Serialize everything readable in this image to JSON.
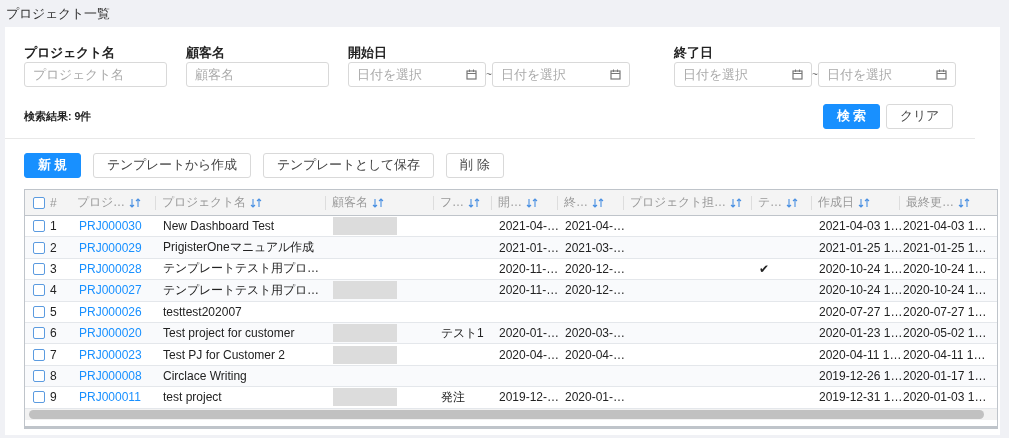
{
  "page_title": "プロジェクト一覧",
  "filters": [
    {
      "kind": "text",
      "label": "プロジェクト名",
      "placeholder": "プロジェクト名"
    },
    {
      "kind": "text",
      "label": "顧客名",
      "placeholder": "顧客名"
    },
    {
      "kind": "range",
      "label": "開始日",
      "placeholder_from": "日付を選択",
      "separator": "~",
      "placeholder_to": "日付を選択"
    },
    {
      "kind": "range",
      "label": "終了日",
      "placeholder_from": "日付を選択",
      "separator": "~",
      "placeholder_to": "日付を選択"
    }
  ],
  "result_count": "検索結果: 9件",
  "search_buttons": [
    {
      "label": "検 索",
      "primary": true
    },
    {
      "label": "クリア",
      "primary": false
    }
  ],
  "toolbar_buttons": [
    {
      "label": "新 規",
      "primary": true
    },
    {
      "label": "テンプレートから作成",
      "primary": false
    },
    {
      "label": "テンプレートとして保存",
      "primary": false
    },
    {
      "label": "削 除",
      "primary": false
    }
  ],
  "table": {
    "all_selected": false,
    "columns": [
      {
        "label": "#",
        "sortable": false
      },
      {
        "label": "プロジ…",
        "sortable": true
      },
      {
        "label": "プロジェクト名",
        "sortable": true
      },
      {
        "label": "顧客名",
        "sortable": true
      },
      {
        "label": "フ…",
        "sortable": true
      },
      {
        "label": "開…",
        "sortable": true
      },
      {
        "label": "終…",
        "sortable": true
      },
      {
        "label": "プロジェクト担…",
        "sortable": true
      },
      {
        "label": "テ…",
        "sortable": true
      },
      {
        "label": "作成日",
        "sortable": true
      },
      {
        "label": "最終更…",
        "sortable": true
      }
    ],
    "rows": [
      {
        "selected": false,
        "cells": [
          "1",
          "PRJ000030",
          "New Dashboard Test",
          "",
          "",
          "2021-04-…",
          "2021-04-…",
          "",
          "",
          "2021-04-03 1…",
          "2021-04-03 1…"
        ],
        "customer_redacted": true
      },
      {
        "selected": false,
        "cells": [
          "2",
          "PRJ000029",
          "PrigisterOneマニュアル作成",
          "",
          "",
          "2021-01-…",
          "2021-03-…",
          "",
          "",
          "2021-01-25 1…",
          "2021-01-25 1…"
        ],
        "customer_redacted": false
      },
      {
        "selected": false,
        "cells": [
          "3",
          "PRJ000028",
          "テンプレートテスト用プロ…",
          "",
          "",
          "2020-11-…",
          "2020-12-…",
          "",
          "✔",
          "2020-10-24 1…",
          "2020-10-24 1…"
        ],
        "customer_redacted": false
      },
      {
        "selected": false,
        "cells": [
          "4",
          "PRJ000027",
          "テンプレートテスト用プロ…",
          "",
          "",
          "2020-11-…",
          "2020-12-…",
          "",
          "",
          "2020-10-24 1…",
          "2020-10-24 1…"
        ],
        "customer_redacted": true
      },
      {
        "selected": false,
        "cells": [
          "5",
          "PRJ000026",
          "testtest202007",
          "",
          "",
          "",
          "",
          "",
          "",
          "2020-07-27 1…",
          "2020-07-27 1…"
        ],
        "customer_redacted": false
      },
      {
        "selected": false,
        "cells": [
          "6",
          "PRJ000020",
          "Test project for customer",
          "",
          "テスト1",
          "2020-01-…",
          "2020-03-…",
          "",
          "",
          "2020-01-23 1…",
          "2020-05-02 1…"
        ],
        "customer_redacted": true
      },
      {
        "selected": false,
        "cells": [
          "7",
          "PRJ000023",
          "Test PJ for Customer 2",
          "",
          "",
          "2020-04-…",
          "2020-04-…",
          "",
          "",
          "2020-04-11 1…",
          "2020-04-11 1…"
        ],
        "customer_redacted": true
      },
      {
        "selected": false,
        "cells": [
          "8",
          "PRJ000008",
          "Circlace Writing",
          "",
          "",
          "",
          "",
          "",
          "",
          "2019-12-26 1…",
          "2020-01-17 1…"
        ],
        "customer_redacted": false
      },
      {
        "selected": false,
        "cells": [
          "9",
          "PRJ000011",
          "test project",
          "",
          "発注",
          "2019-12-…",
          "2020-01-…",
          "",
          "",
          "2019-12-31 1…",
          "2020-01-03 1…"
        ],
        "customer_redacted": true
      }
    ]
  }
}
